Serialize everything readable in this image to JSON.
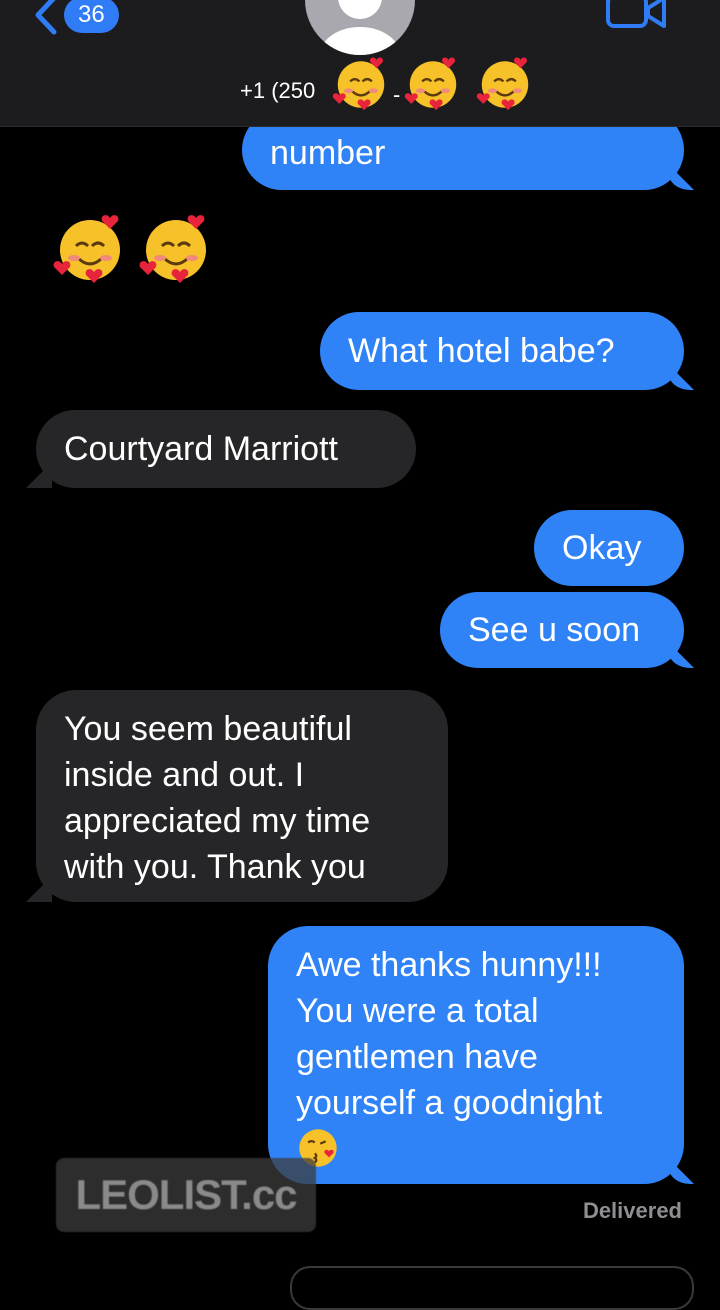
{
  "nav": {
    "back_count": "36",
    "contact_prefix": "+1 (250",
    "contact_dash": "-"
  },
  "messages": [
    {
      "dir": "sent",
      "text": "number"
    },
    {
      "dir": "recv",
      "emoji": "smiling-face-with-hearts x2"
    },
    {
      "dir": "sent",
      "text": "What hotel babe?"
    },
    {
      "dir": "recv",
      "text": "Courtyard Marriott"
    },
    {
      "dir": "sent",
      "text": "Okay"
    },
    {
      "dir": "sent",
      "text": "See u soon"
    },
    {
      "dir": "recv",
      "text": "You seem beautiful inside and out. I appreciated my time with you. Thank you"
    },
    {
      "dir": "sent",
      "text": "Awe thanks hunny!!! You were a total gentlemen have yourself a goodnight",
      "emoji": "face-blowing-a-kiss"
    }
  ],
  "status": {
    "delivered": "Delivered"
  },
  "watermark": {
    "text": "LEOLIST.cc"
  },
  "colors": {
    "sent_bubble": "#2f83f7",
    "recv_bubble": "#262628",
    "header_bg": "#1c1c1e",
    "badge": "#2f7cf6"
  }
}
